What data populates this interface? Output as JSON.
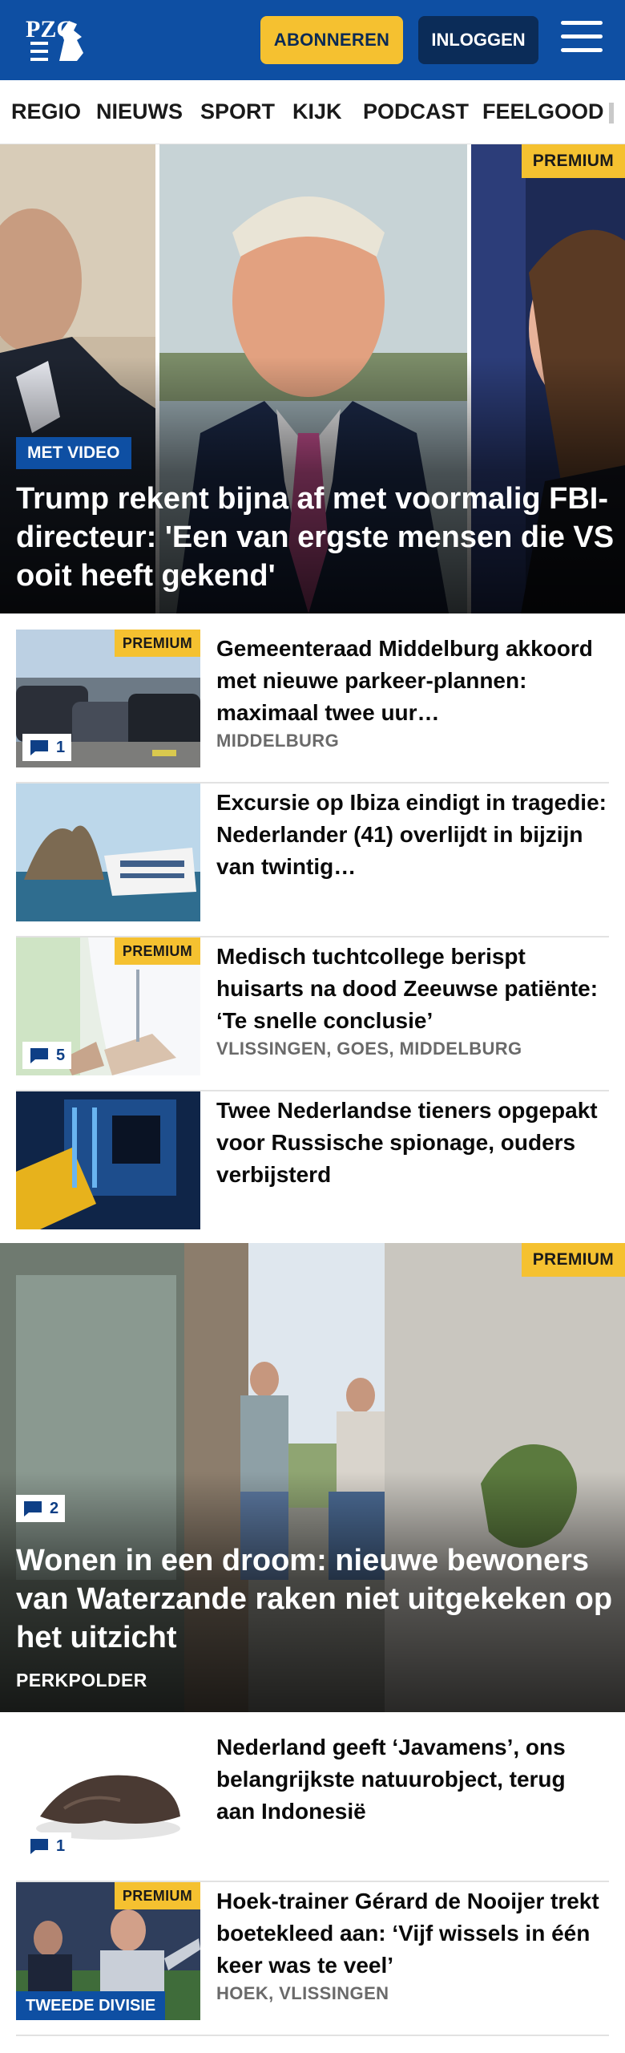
{
  "header": {
    "logo_text": "PZC",
    "subscribe_label": "ABONNEREN",
    "login_label": "INLOGGEN"
  },
  "nav": {
    "items": [
      "REGIO",
      "NIEUWS",
      "SPORT",
      "KIJK",
      "PODCAST",
      "FEELGOOD"
    ]
  },
  "hero": {
    "premium_label": "PREMIUM",
    "video_badge": "MET VIDEO",
    "title": "Trump rekent bijna af met voormalig FBI-directeur: 'Een van ergste mensen die VS ooit heeft gekend'"
  },
  "articles": [
    {
      "premium_label": "PREMIUM",
      "comments": "1",
      "title": "Gemeenteraad Middelburg akkoord met nieuwe parkeer-plannen: maximaal twee uur…",
      "location": "MIDDELBURG"
    },
    {
      "title": "Excursie op Ibiza eindigt in tragedie: Nederlander (41) overlijdt in bijzijn van twintig…"
    },
    {
      "premium_label": "PREMIUM",
      "comments": "5",
      "title": "Medisch tuchtcollege berispt huisarts na dood Zeeuwse patiënte: ‘Te snelle conclusie’",
      "location": "VLISSINGEN, GOES, MIDDELBURG"
    },
    {
      "title": "Twee Nederlandse tieners opgepakt voor Russische spionage, ouders verbijsterd"
    }
  ],
  "feature": {
    "premium_label": "PREMIUM",
    "comments": "2",
    "title": "Wonen in een droom: nieuwe bewoners van Waterzande raken niet uitgekeken op het uitzicht",
    "location": "PERKPOLDER"
  },
  "articles_2": [
    {
      "comments": "1",
      "title": "Nederland geeft ‘Javamens’, ons belangrijkste natuurobject, terug aan Indonesië"
    },
    {
      "premium_label": "PREMIUM",
      "division_tag": "TWEEDE DIVISIE",
      "title": "Hoek-trainer Gérard de Nooijer trekt boetekleed aan: ‘Vijf wissels in één keer was te veel’",
      "location": "HOEK, VLISSINGEN"
    }
  ],
  "colors": {
    "brand_blue": "#0e4fa3",
    "accent_yellow": "#f5c130",
    "dark_navy": "#0b2c58"
  }
}
